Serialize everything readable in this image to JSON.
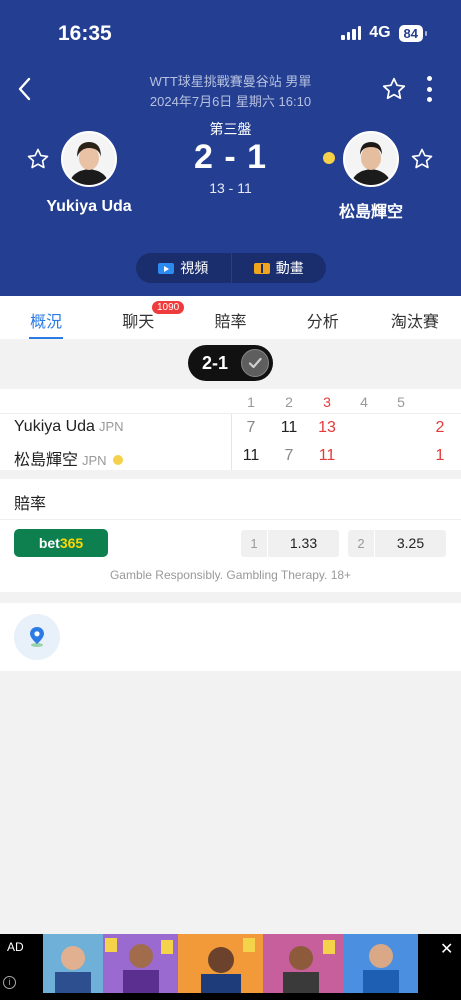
{
  "status_bar": {
    "time": "16:35",
    "network": "4G",
    "battery": "84"
  },
  "header": {
    "tournament": "WTT球星挑戰賽曼谷站 男單",
    "datetime": "2024年7月6日 星期六 16:10",
    "set_label": "第三盤",
    "score": "2 - 1",
    "set_score": "13 - 11"
  },
  "players": {
    "left": {
      "name": "Yukiya Uda"
    },
    "right": {
      "name": "松島輝空"
    }
  },
  "media": {
    "video": "視頻",
    "animation": "動畫"
  },
  "tabs": [
    {
      "label": "概況",
      "active": true
    },
    {
      "label": "聊天",
      "badge": "1090"
    },
    {
      "label": "賠率"
    },
    {
      "label": "分析"
    },
    {
      "label": "淘汰賽"
    }
  ],
  "result_pill": {
    "text": "2-1"
  },
  "score_table": {
    "set_headers": [
      "1",
      "2",
      "3",
      "4",
      "5"
    ],
    "rows": [
      {
        "name": "Yukiya Uda",
        "country": "JPN",
        "sets": [
          "7",
          "11",
          "13"
        ],
        "total": "2"
      },
      {
        "name": "松島輝空",
        "country": "JPN",
        "sets": [
          "11",
          "7",
          "11"
        ],
        "total": "1"
      }
    ]
  },
  "odds": {
    "title": "賠率",
    "bookmaker_a": "bet",
    "bookmaker_b": "365",
    "home_label": "1",
    "home_value": "1.33",
    "away_label": "2",
    "away_value": "3.25",
    "disclaimer": "Gamble Responsibly. Gambling Therapy. 18+"
  },
  "ad": {
    "label": "AD",
    "info": "i",
    "close": "✕"
  },
  "colors": {
    "header_bg": "#243f91",
    "accent": "#2c7be5",
    "red": "#e23b3b",
    "serve": "#f5d04a",
    "bet365": "#0e7f4e"
  }
}
